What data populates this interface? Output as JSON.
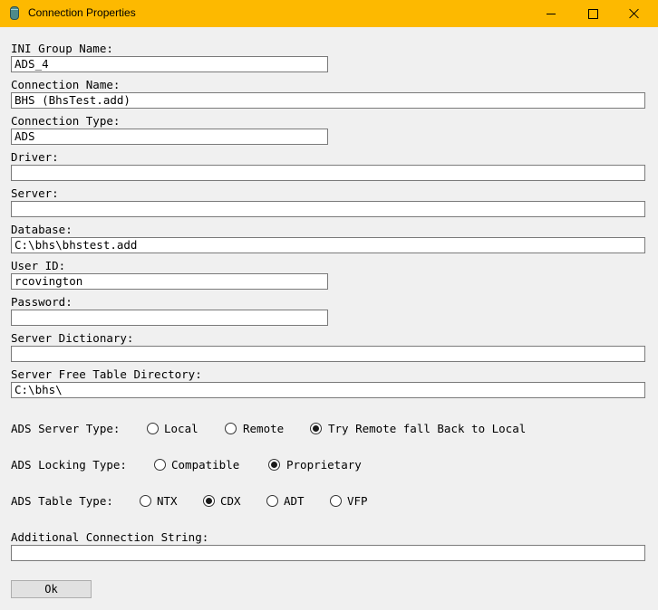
{
  "window": {
    "title": "Connection Properties"
  },
  "fields": {
    "ini_group": {
      "label": "INI Group Name:",
      "value": "ADS_4"
    },
    "connection_name": {
      "label": "Connection Name:",
      "value": "BHS (BhsTest.add)"
    },
    "connection_type": {
      "label": "Connection Type:",
      "value": "ADS"
    },
    "driver": {
      "label": "Driver:",
      "value": ""
    },
    "server": {
      "label": "Server:",
      "value": ""
    },
    "database": {
      "label": "Database:",
      "value": "C:\\bhs\\bhstest.add"
    },
    "user_id": {
      "label": "User ID:",
      "value": "rcovington"
    },
    "password": {
      "label": "Password:",
      "value": ""
    },
    "server_dictionary": {
      "label": "Server Dictionary:",
      "value": ""
    },
    "server_free_table_dir": {
      "label": "Server Free Table Directory:",
      "value": "C:\\bhs\\"
    },
    "additional_conn": {
      "label": "Additional Connection String:",
      "value": ""
    }
  },
  "ads_server_type": {
    "label": "ADS Server Type:",
    "options": [
      "Local",
      "Remote",
      "Try Remote fall Back to Local"
    ],
    "selected": "Try Remote fall Back to Local"
  },
  "ads_locking_type": {
    "label": "ADS Locking Type:",
    "options": [
      "Compatible",
      "Proprietary"
    ],
    "selected": "Proprietary"
  },
  "ads_table_type": {
    "label": "ADS Table Type:",
    "options": [
      "NTX",
      "CDX",
      "ADT",
      "VFP"
    ],
    "selected": "CDX"
  },
  "buttons": {
    "ok": "Ok"
  }
}
